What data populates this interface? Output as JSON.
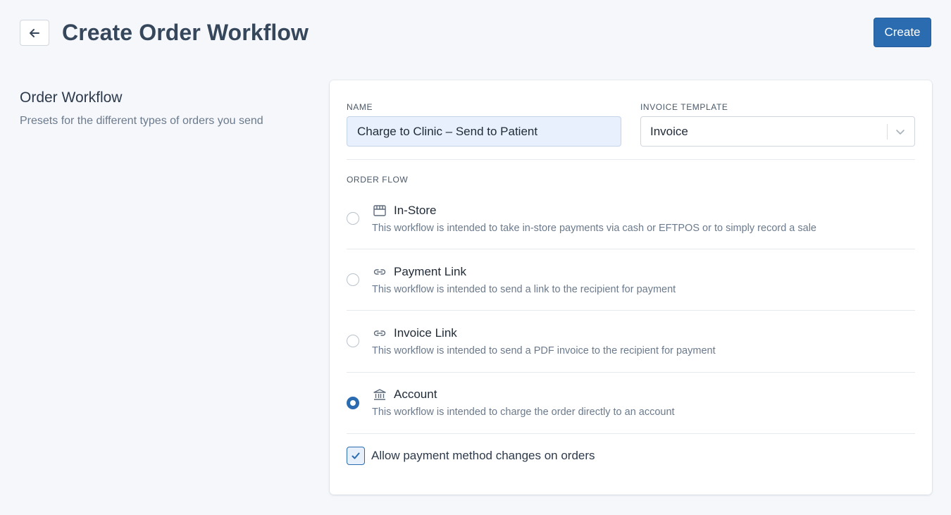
{
  "header": {
    "title": "Create Order Workflow",
    "create_label": "Create"
  },
  "section": {
    "title": "Order Workflow",
    "description": "Presets for the different types of orders you send"
  },
  "form": {
    "name_label": "NAME",
    "name_value": "Charge to Clinic – Send to Patient",
    "invoice_template_label": "INVOICE TEMPLATE",
    "invoice_template_value": "Invoice",
    "order_flow_label": "ORDER FLOW",
    "options": [
      {
        "icon": "storefront-icon",
        "title": "In-Store",
        "description": "This workflow is intended to take in-store payments via cash or EFTPOS or to simply record a sale",
        "selected": false
      },
      {
        "icon": "link-icon",
        "title": "Payment Link",
        "description": "This workflow is intended to send a link to the recipient for payment",
        "selected": false
      },
      {
        "icon": "link-icon",
        "title": "Invoice Link",
        "description": "This workflow is intended to send a PDF invoice to the recipient for payment",
        "selected": false
      },
      {
        "icon": "bank-icon",
        "title": "Account",
        "description": "This workflow is intended to charge the order directly to an account",
        "selected": true
      }
    ],
    "allow_changes_label": "Allow payment method changes on orders",
    "allow_changes_checked": true
  },
  "colors": {
    "primary": "#2b6cb0",
    "background": "#f5f7fa",
    "input_fill": "#e8f0fe"
  }
}
